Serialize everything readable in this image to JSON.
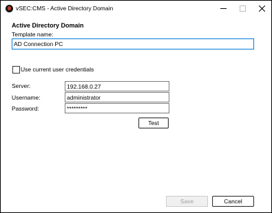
{
  "window": {
    "title": "vSEC:CMS - Active Directory Domain"
  },
  "dialog": {
    "heading": "Active Directory Domain",
    "template_name_label": "Template name:",
    "template_name_value": "AD Connection PC",
    "use_credentials_label": "Use current user credentials",
    "use_credentials_checked": false,
    "server_label": "Server:",
    "server_value": "192.168.0.27",
    "username_label": "Username:",
    "username_value": "administrator",
    "password_label": "Password:",
    "password_value": "*********"
  },
  "buttons": {
    "test_label": "Test",
    "save_label": "Save",
    "save_enabled": false,
    "cancel_label": "Cancel"
  },
  "colors": {
    "focus_border": "#0078d7",
    "disabled_text": "#a0a0a0",
    "app_icon_accent": "#c0392b"
  },
  "icons": {
    "app": "vsec-app-icon",
    "minimize": "minimize-icon",
    "maximize": "maximize-icon",
    "close": "close-icon"
  }
}
